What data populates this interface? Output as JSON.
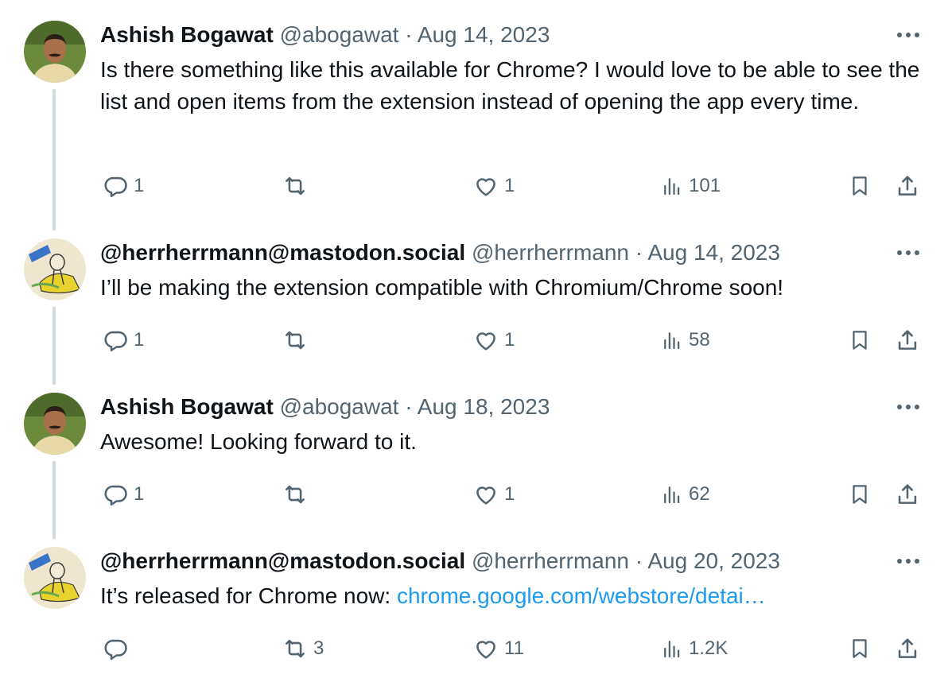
{
  "tweets": [
    {
      "name": "Ashish Bogawat",
      "handle": "@abogawat",
      "dot": "·",
      "date": "Aug 14, 2023",
      "text": "Is there something like this available for Chrome? I would love to be able to see the list and open items from the extension instead of opening the app every time.",
      "link": "",
      "replies": "1",
      "reposts": "",
      "likes": "1",
      "views": "101",
      "avatar_icon": "person-photo"
    },
    {
      "name": "@herrherrmann@mastodon.social",
      "handle": "@herrherrmann",
      "dot": "·",
      "date": "Aug 14, 2023",
      "text": "I’ll be making the extension compatible with Chromium/Chrome soon!",
      "link": "",
      "replies": "1",
      "reposts": "",
      "likes": "1",
      "views": "58",
      "avatar_icon": "cartoon-drawing"
    },
    {
      "name": "Ashish Bogawat",
      "handle": "@abogawat",
      "dot": "·",
      "date": "Aug 18, 2023",
      "text": "Awesome! Looking forward to it.",
      "link": "",
      "replies": "1",
      "reposts": "",
      "likes": "1",
      "views": "62",
      "avatar_icon": "person-photo"
    },
    {
      "name": "@herrherrmann@mastodon.social",
      "handle": "@herrherrmann",
      "dot": "·",
      "date": "Aug 20, 2023",
      "text": "It’s released for Chrome now: ",
      "link": "chrome.google.com/webstore/detai…",
      "replies": "",
      "reposts": "3",
      "likes": "11",
      "views": "1.2K",
      "avatar_icon": "cartoon-drawing"
    }
  ],
  "colors": {
    "text": "#0f1419",
    "secondary": "#536471",
    "link": "#1d9bf0",
    "thread_line": "#cfd9de"
  }
}
